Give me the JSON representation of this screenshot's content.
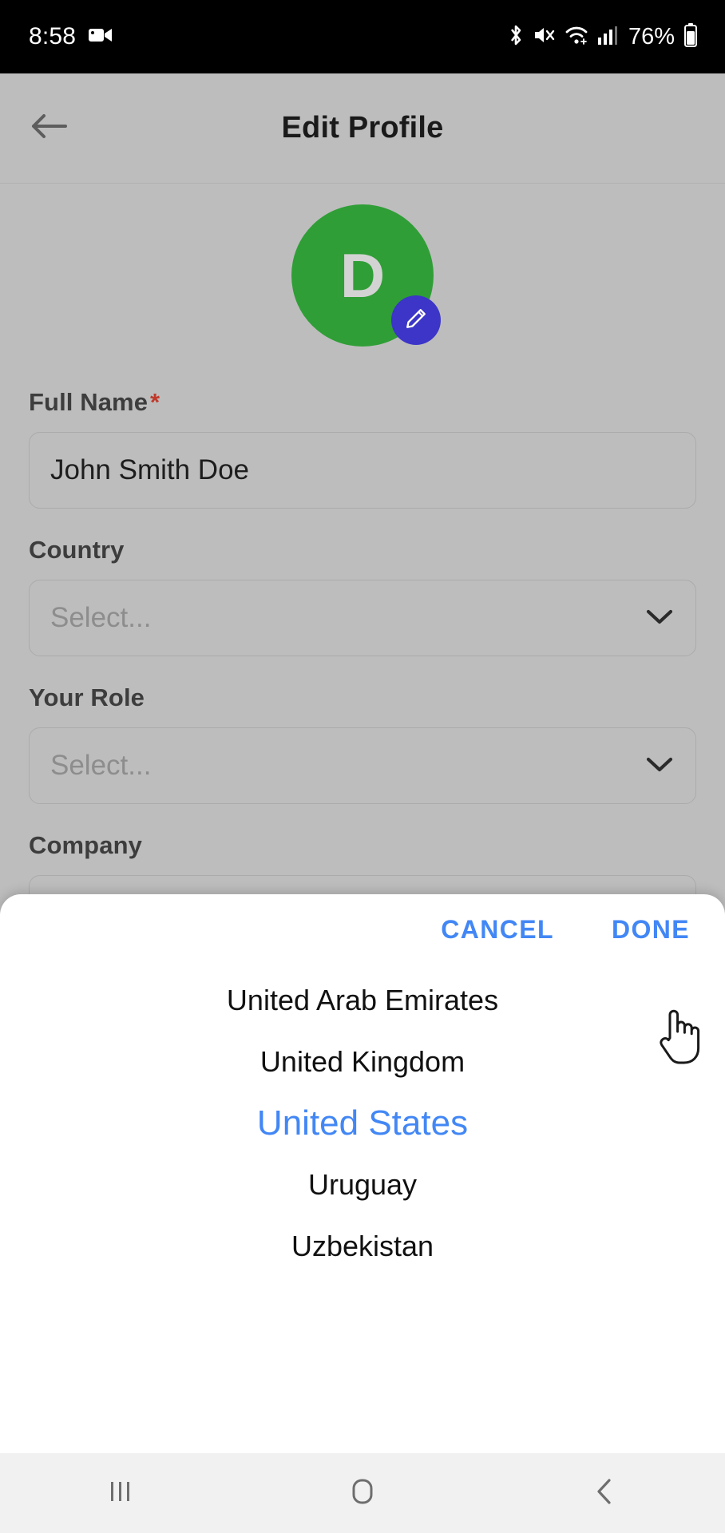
{
  "status_bar": {
    "time": "8:58",
    "battery_percent": "76%",
    "icons": [
      "video-camera-icon",
      "bluetooth-icon",
      "mute-icon",
      "wifi-icon",
      "cellular-signal-icon",
      "battery-icon"
    ]
  },
  "appbar": {
    "title": "Edit Profile",
    "back_icon": "arrow-left-icon"
  },
  "avatar": {
    "initial": "D",
    "bg_color": "#2f9e36",
    "badge_color": "#3c35c8",
    "badge_icon": "pencil-icon"
  },
  "form": {
    "fields": [
      {
        "label": "Full Name",
        "required": true,
        "required_marker": "*",
        "value": "John Smith Doe",
        "type": "text"
      },
      {
        "label": "Country",
        "required": false,
        "placeholder": "Select...",
        "type": "select",
        "chevron_icon": "chevron-down-icon"
      },
      {
        "label": "Your Role",
        "required": false,
        "placeholder": "Select...",
        "type": "select",
        "chevron_icon": "chevron-down-icon"
      },
      {
        "label": "Company",
        "required": false,
        "placeholder": "",
        "type": "text"
      }
    ]
  },
  "sheet": {
    "cancel_label": "CANCEL",
    "done_label": "DONE",
    "accent_color": "#4287f5",
    "options": [
      "United Arab Emirates",
      "United Kingdom",
      "United States",
      "Uruguay",
      "Uzbekistan"
    ],
    "selected_index": 2,
    "selected_value": "United States"
  },
  "navbar": {
    "recents_icon": "recents-icon",
    "home_icon": "home-icon",
    "back_icon": "back-chevron-icon"
  },
  "cursor": {
    "type": "pointing-hand-cursor"
  }
}
